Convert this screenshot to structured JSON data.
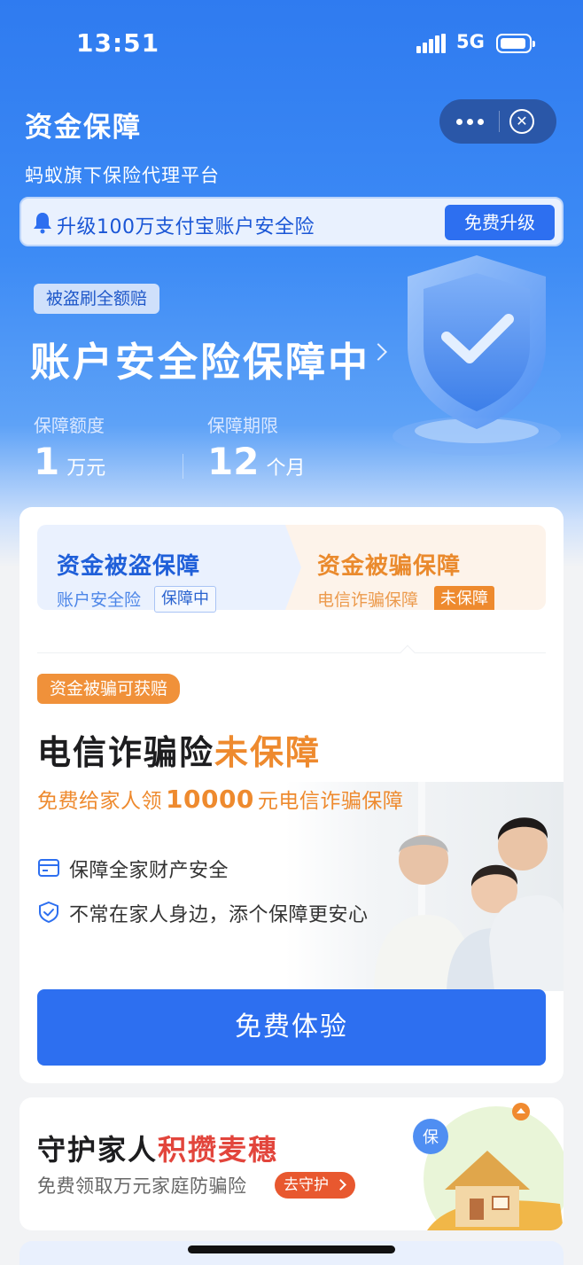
{
  "status_bar": {
    "time": "13:51",
    "network": "5G"
  },
  "header": {
    "title": "资金保障",
    "subtitle": "蚂蚁旗下保险代理平台"
  },
  "notice": {
    "text": "升级100万支付宝账户安全险",
    "button": "免费升级"
  },
  "hero": {
    "tag": "被盗刷全额赔",
    "title": "账户安全险保障中",
    "stats": [
      {
        "label": "保障额度",
        "value": "1",
        "unit": "万元"
      },
      {
        "label": "保障期限",
        "value": "12",
        "unit": "个月"
      }
    ]
  },
  "segments": {
    "left": {
      "title": "资金被盗保障",
      "sub": "账户安全险",
      "badge": "保障中"
    },
    "right": {
      "title": "资金被骗保障",
      "sub": "电信诈骗保障",
      "badge": "未保障"
    }
  },
  "card": {
    "claim_tag": "资金被骗可获赔",
    "title_main": "电信诈骗险",
    "title_highlight": "未保障",
    "promo_before": "免费给家人领",
    "promo_amount": "10000",
    "promo_after": "元电信诈骗保障",
    "features": [
      "保障全家财产安全",
      "不常在家人身边，添个保障更安心"
    ],
    "cta": "免费体验"
  },
  "card2": {
    "title_main": "守护家人",
    "title_highlight": "积攒麦穗",
    "desc": "免费领取万元家庭防骗险",
    "button": "去守护",
    "badge_char": "保"
  },
  "colors": {
    "primary": "#2d6ff0",
    "accent_orange": "#ee8a2e",
    "accent_red": "#e2453c"
  }
}
